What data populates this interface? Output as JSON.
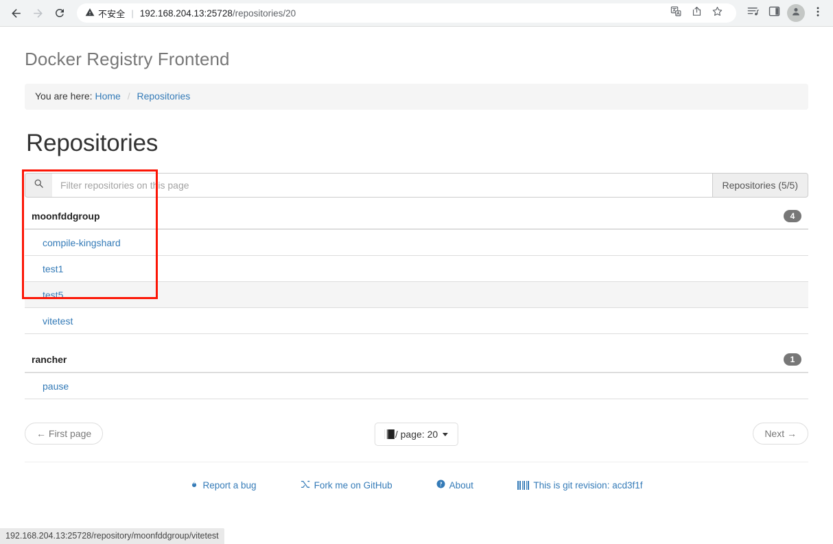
{
  "browser": {
    "back_icon": "back-arrow-icon",
    "forward_icon": "forward-arrow-icon",
    "reload_icon": "reload-icon",
    "security_label": "不安全",
    "security_divider": "|",
    "url_host": "192.168.204.13:25728",
    "url_path": "/repositories/20",
    "translate_icon": "translate-icon",
    "share_icon": "share-icon",
    "bookmark_icon": "star-icon",
    "reading_list_icon": "reading-list-icon",
    "side_panel_icon": "side-panel-icon",
    "profile_icon": "profile-avatar-icon",
    "menu_icon": "three-dot-menu-icon"
  },
  "app": {
    "title": "Docker Registry Frontend",
    "breadcrumb": {
      "prefix": "You are here:",
      "home": "Home",
      "separator": "/",
      "current": "Repositories"
    },
    "heading": "Repositories"
  },
  "filter": {
    "search_icon": "search-icon",
    "placeholder": "Filter repositories on this page",
    "value": "",
    "count_label": "Repositories (5/5)"
  },
  "groups": [
    {
      "name": "moonfddgroup",
      "count": "4",
      "repos": [
        {
          "name": "compile-kingshard"
        },
        {
          "name": "test1"
        },
        {
          "name": "test5"
        },
        {
          "name": "vitetest"
        }
      ]
    },
    {
      "name": "rancher",
      "count": "1",
      "repos": [
        {
          "name": "pause"
        }
      ]
    }
  ],
  "pagination": {
    "first_page": "← First page",
    "next_page": "Next →",
    "per_page_icon": "book-icon",
    "per_page_label": "/ page: 20",
    "caret_icon": "caret-down-icon"
  },
  "footer": {
    "report_bug_icon": "fire-icon",
    "report_bug": "Report a bug",
    "fork_icon": "code-fork-icon",
    "fork": "Fork me on GitHub",
    "about_icon": "question-circle-icon",
    "about": "About",
    "revision_icon": "barcode-icon",
    "revision": "This is git revision: acd3f1f"
  },
  "status_bar": {
    "text": "192.168.204.13:25728/repository/moonfddgroup/vitetest"
  },
  "colors": {
    "link": "#337ab7",
    "badge": "#777777",
    "annotation": "#fc1505",
    "stripe": "#f5f5f5"
  }
}
